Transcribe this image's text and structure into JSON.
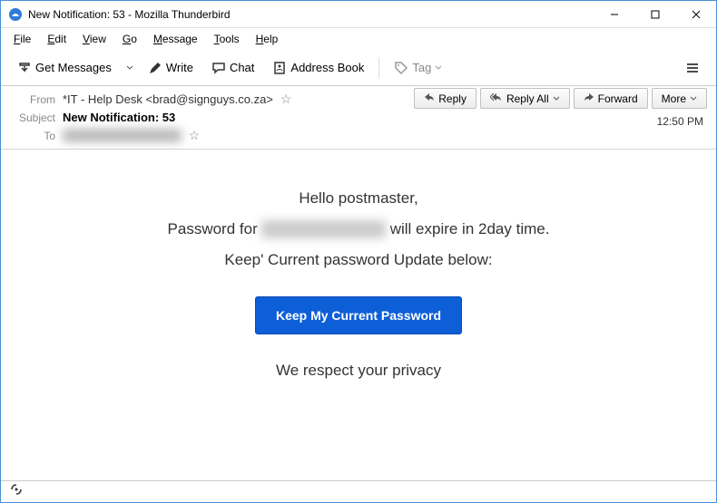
{
  "window": {
    "title": "New Notification: 53 - Mozilla Thunderbird"
  },
  "menu": {
    "file": "File",
    "edit": "Edit",
    "view": "View",
    "go": "Go",
    "message": "Message",
    "tools": "Tools",
    "help": "Help"
  },
  "toolbar": {
    "get_messages": "Get Messages",
    "write": "Write",
    "chat": "Chat",
    "address_book": "Address Book",
    "tag": "Tag"
  },
  "headers": {
    "from_label": "From",
    "from_value": "*IT - Help Desk <brad@signguys.co.za>",
    "subject_label": "Subject",
    "subject_value": "New Notification: 53",
    "to_label": "To",
    "to_value": "redacted",
    "time": "12:50 PM"
  },
  "actions": {
    "reply": "Reply",
    "reply_all": "Reply All",
    "forward": "Forward",
    "more": "More"
  },
  "body": {
    "greeting": "Hello postmaster,",
    "pw_prefix": "Password for ",
    "pw_redacted": "xxxxxxxxx",
    "pw_suffix": " will expire in 2day time.",
    "keep_line": "Keep' Current password Update below:",
    "cta": "Keep My Current Password",
    "privacy": "We respect your privacy"
  }
}
